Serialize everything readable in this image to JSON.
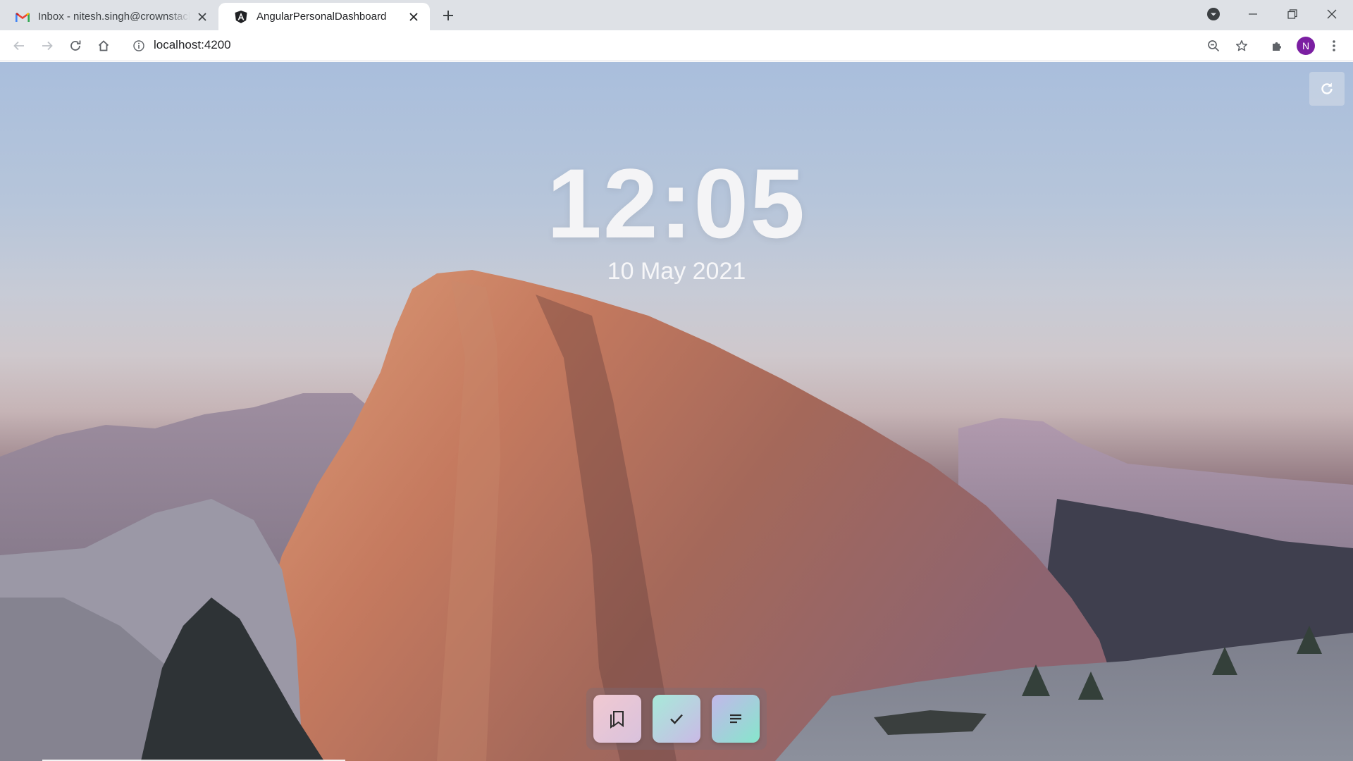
{
  "browser": {
    "tabs": [
      {
        "title": "Inbox - nitesh.singh@crownstack.com",
        "favicon": "gmail-icon",
        "active": false
      },
      {
        "title": "AngularPersonalDashboard",
        "favicon": "angular-icon",
        "active": true
      }
    ],
    "url": "localhost:4200",
    "profile_initial": "N",
    "profile_color": "#7b1fa2"
  },
  "dashboard": {
    "time": "12:05",
    "date": "10 May 2021",
    "refresh_icon": "refresh-icon",
    "dock": [
      {
        "name": "bookmarks",
        "icon": "bookmarks-icon"
      },
      {
        "name": "todos",
        "icon": "check-icon"
      },
      {
        "name": "notes",
        "icon": "notes-icon"
      }
    ]
  }
}
